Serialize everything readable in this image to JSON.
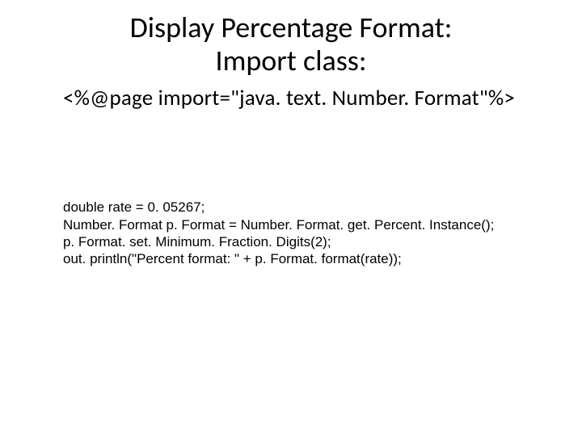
{
  "title_line1": "Display Percentage Format:",
  "title_line2": "Import class:",
  "subtitle": "<%@page import=\"java. text. Number. Format\"%>",
  "code": {
    "l1": "double rate = 0. 05267;",
    "l2": "Number. Format p. Format = Number. Format. get. Percent. Instance();",
    "l3": "p. Format. set. Minimum. Fraction. Digits(2);",
    "l4": "out. println(\"Percent format: \" + p. Format. format(rate));"
  }
}
